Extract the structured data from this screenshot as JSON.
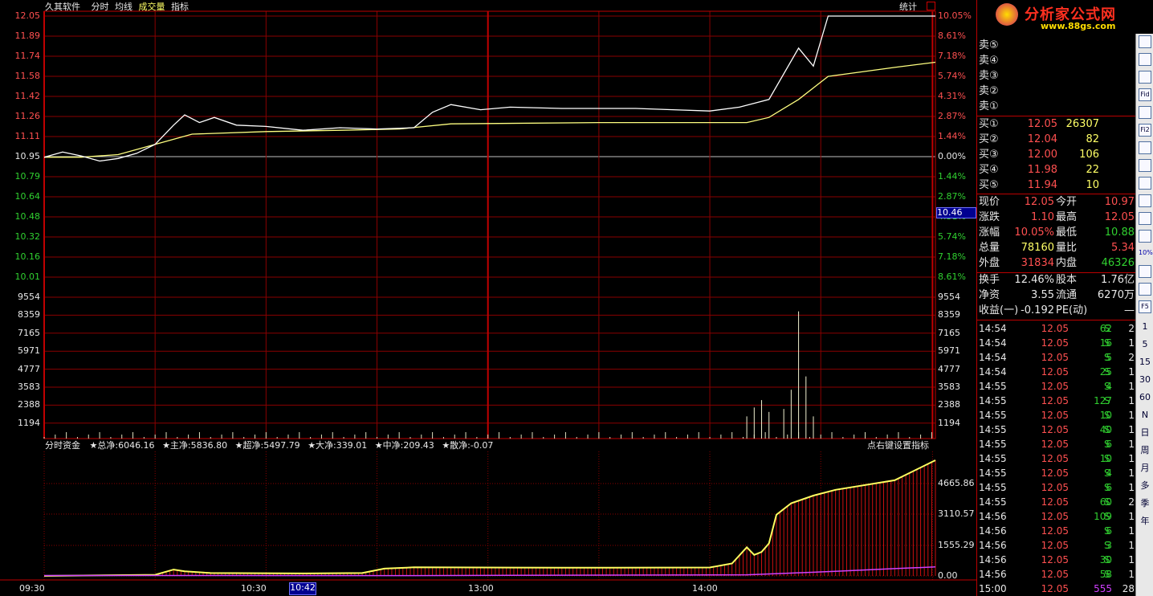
{
  "header": {
    "app": "久其软件",
    "menu": [
      "分时",
      "均线",
      "成交量",
      "指标"
    ],
    "stat_btn": "统计"
  },
  "logo": {
    "text": "分析家公式网",
    "url": "www.88gs.com"
  },
  "price_axis_left": [
    "12.05",
    "11.89",
    "11.74",
    "11.58",
    "11.42",
    "11.26",
    "11.11",
    "10.95",
    "10.79",
    "10.64",
    "10.48",
    "10.32",
    "10.16",
    "10.01"
  ],
  "pct_axis_right": [
    "10.05%",
    "8.61%",
    "7.18%",
    "5.74%",
    "4.31%",
    "2.87%",
    "1.44%",
    "0.00%",
    "1.44%",
    "2.87%",
    "4.31%",
    "5.74%",
    "7.18%",
    "8.61%"
  ],
  "current_marker": "10.46",
  "volume_axis": [
    "9554",
    "8359",
    "7165",
    "5971",
    "4777",
    "3583",
    "2388",
    "1194"
  ],
  "fund_title": "分时资金",
  "fund_items": [
    "★总净:6046.16",
    "★主净:5836.80",
    "★超净:5497.79",
    "★大净:339.01",
    "★中净:209.43",
    "★散净:-0.07"
  ],
  "fund_hint": "点右键设置指标",
  "fund_axis": [
    "4665.86",
    "3110.57",
    "1555.29",
    "0.00"
  ],
  "time_axis": [
    "09:30",
    "10:30",
    "10:42",
    "13:00",
    "14:00"
  ],
  "chart_data": {
    "type": "line",
    "price_range": [
      9.86,
      12.05
    ],
    "prev_close": 10.95,
    "price_series": [
      [
        0,
        10.95
      ],
      [
        5,
        10.99
      ],
      [
        10,
        10.96
      ],
      [
        15,
        10.92
      ],
      [
        20,
        10.94
      ],
      [
        25,
        10.98
      ],
      [
        30,
        11.05
      ],
      [
        35,
        11.2
      ],
      [
        38,
        11.28
      ],
      [
        42,
        11.22
      ],
      [
        46,
        11.26
      ],
      [
        52,
        11.2
      ],
      [
        60,
        11.19
      ],
      [
        70,
        11.16
      ],
      [
        80,
        11.18
      ],
      [
        90,
        11.17
      ],
      [
        100,
        11.18
      ],
      [
        105,
        11.3
      ],
      [
        110,
        11.36
      ],
      [
        118,
        11.32
      ],
      [
        126,
        11.34
      ],
      [
        140,
        11.33
      ],
      [
        160,
        11.33
      ],
      [
        170,
        11.32
      ],
      [
        180,
        11.31
      ],
      [
        188,
        11.34
      ],
      [
        196,
        11.4
      ],
      [
        204,
        11.8
      ],
      [
        208,
        11.66
      ],
      [
        212,
        12.05
      ],
      [
        241,
        12.05
      ]
    ],
    "avg_series": [
      [
        0,
        10.95
      ],
      [
        10,
        10.95
      ],
      [
        20,
        10.97
      ],
      [
        30,
        11.05
      ],
      [
        40,
        11.13
      ],
      [
        60,
        11.15
      ],
      [
        80,
        11.16
      ],
      [
        96,
        11.17
      ],
      [
        110,
        11.21
      ],
      [
        150,
        11.22
      ],
      [
        190,
        11.22
      ],
      [
        196,
        11.26
      ],
      [
        204,
        11.4
      ],
      [
        212,
        11.58
      ],
      [
        230,
        11.65
      ],
      [
        241,
        11.69
      ]
    ],
    "volume_max": 9554,
    "volume_spikes": [
      [
        190,
        1500
      ],
      [
        192,
        2100
      ],
      [
        194,
        2600
      ],
      [
        196,
        1800
      ],
      [
        200,
        2000
      ],
      [
        202,
        3300
      ],
      [
        204,
        8600
      ],
      [
        206,
        4200
      ],
      [
        208,
        1500
      ]
    ],
    "fund_max": 6046.16,
    "fund_series": [
      [
        0,
        0
      ],
      [
        30,
        60
      ],
      [
        35,
        330
      ],
      [
        38,
        240
      ],
      [
        45,
        150
      ],
      [
        70,
        130
      ],
      [
        86,
        150
      ],
      [
        92,
        380
      ],
      [
        100,
        450
      ],
      [
        140,
        430
      ],
      [
        180,
        440
      ],
      [
        186,
        650
      ],
      [
        190,
        1500
      ],
      [
        192,
        1100
      ],
      [
        194,
        1250
      ],
      [
        196,
        1700
      ],
      [
        198,
        3200
      ],
      [
        202,
        3800
      ],
      [
        208,
        4200
      ],
      [
        214,
        4500
      ],
      [
        230,
        5000
      ],
      [
        241,
        6046.16
      ]
    ],
    "retail_series": [
      [
        0,
        20
      ],
      [
        100,
        15
      ],
      [
        190,
        60
      ],
      [
        214,
        240
      ],
      [
        230,
        380
      ],
      [
        241,
        470
      ]
    ]
  },
  "order_book": {
    "asks": [
      {
        "label": "卖⑤",
        "price": "",
        "vol": ""
      },
      {
        "label": "卖④",
        "price": "",
        "vol": ""
      },
      {
        "label": "卖③",
        "price": "",
        "vol": ""
      },
      {
        "label": "卖②",
        "price": "",
        "vol": ""
      },
      {
        "label": "卖①",
        "price": "",
        "vol": ""
      }
    ],
    "bids": [
      {
        "label": "买①",
        "price": "12.05",
        "vol": "26307"
      },
      {
        "label": "买②",
        "price": "12.04",
        "vol": "82"
      },
      {
        "label": "买③",
        "price": "12.00",
        "vol": "106"
      },
      {
        "label": "买④",
        "price": "11.98",
        "vol": "22"
      },
      {
        "label": "买⑤",
        "price": "11.94",
        "vol": "10"
      }
    ]
  },
  "quote": [
    {
      "k1": "现价",
      "v1": "12.05",
      "k2": "今开",
      "v2": "10.97"
    },
    {
      "k1": "涨跌",
      "v1": "1.10",
      "k2": "最高",
      "v2": "12.05"
    },
    {
      "k1": "涨幅",
      "v1": "10.05%",
      "k2": "最低",
      "v2": "10.88"
    },
    {
      "k1": "总量",
      "v1": "78160",
      "k2": "量比",
      "v2": "5.34"
    },
    {
      "k1": "外盘",
      "v1": "31834",
      "k2": "内盘",
      "v2": "46326"
    }
  ],
  "fundamentals": [
    {
      "k1": "换手",
      "v1": "12.46%",
      "k2": "股本",
      "v2": "1.76亿"
    },
    {
      "k1": "净资",
      "v1": "3.55",
      "k2": "流通",
      "v2": "6270万"
    },
    {
      "k1": "收益(一)",
      "v1": "-0.192",
      "k2": "PE(动)",
      "v2": "—"
    }
  ],
  "ticks": [
    {
      "t": "14:54",
      "p": "12.05",
      "v": "62",
      "s": "S",
      "n": "2"
    },
    {
      "t": "14:54",
      "p": "12.05",
      "v": "16",
      "s": "S",
      "n": "1"
    },
    {
      "t": "14:54",
      "p": "12.05",
      "v": "5",
      "s": "S",
      "n": "2"
    },
    {
      "t": "14:54",
      "p": "12.05",
      "v": "25",
      "s": "S",
      "n": "1"
    },
    {
      "t": "14:55",
      "p": "12.05",
      "v": "4",
      "s": "S",
      "n": "1"
    },
    {
      "t": "14:55",
      "p": "12.05",
      "v": "127",
      "s": "S",
      "n": "1"
    },
    {
      "t": "14:55",
      "p": "12.05",
      "v": "10",
      "s": "S",
      "n": "1"
    },
    {
      "t": "14:55",
      "p": "12.05",
      "v": "40",
      "s": "S",
      "n": "1"
    },
    {
      "t": "14:55",
      "p": "12.05",
      "v": "6",
      "s": "S",
      "n": "1"
    },
    {
      "t": "14:55",
      "p": "12.05",
      "v": "10",
      "s": "S",
      "n": "1"
    },
    {
      "t": "14:55",
      "p": "12.05",
      "v": "4",
      "s": "S",
      "n": "1"
    },
    {
      "t": "14:55",
      "p": "12.05",
      "v": "6",
      "s": "S",
      "n": "1"
    },
    {
      "t": "14:55",
      "p": "12.05",
      "v": "60",
      "s": "S",
      "n": "2"
    },
    {
      "t": "14:56",
      "p": "12.05",
      "v": "109",
      "s": "S",
      "n": "1"
    },
    {
      "t": "14:56",
      "p": "12.05",
      "v": "6",
      "s": "S",
      "n": "1"
    },
    {
      "t": "14:56",
      "p": "12.05",
      "v": "3",
      "s": "S",
      "n": "1"
    },
    {
      "t": "14:56",
      "p": "12.05",
      "v": "30",
      "s": "S",
      "n": "1"
    },
    {
      "t": "14:56",
      "p": "12.05",
      "v": "58",
      "s": "S",
      "n": "1"
    },
    {
      "t": "15:00",
      "p": "12.05",
      "v": "555",
      "s": "",
      "n": "28"
    }
  ],
  "toolbar": [
    "1",
    "5",
    "15",
    "30",
    "60",
    "N",
    "日",
    "周",
    "月",
    "多",
    "季",
    "年"
  ],
  "toolbar_icons": [
    "Fid",
    "Fi2",
    "F5",
    "10%"
  ]
}
